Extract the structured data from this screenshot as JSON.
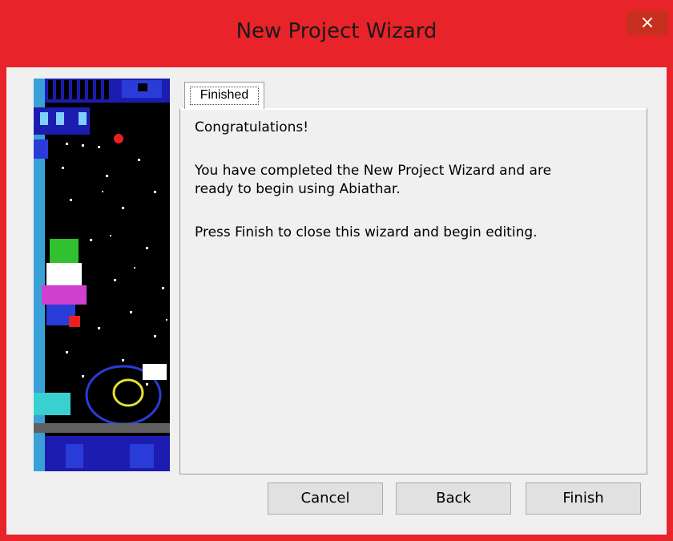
{
  "window": {
    "title": "New Project Wizard",
    "close_glyph": "×",
    "accent_color": "#e8232a"
  },
  "tab": {
    "label": "Finished"
  },
  "content": {
    "heading": "Congratulations!",
    "line1": "You have completed the New Project Wizard and are",
    "line2": "ready to begin using Abiathar.",
    "line3": "Press Finish to close this wizard and begin editing."
  },
  "buttons": {
    "cancel": "Cancel",
    "back": "Back",
    "finish": "Finish"
  },
  "side_art": {
    "icon": "keen-pixel-art-illustration"
  }
}
